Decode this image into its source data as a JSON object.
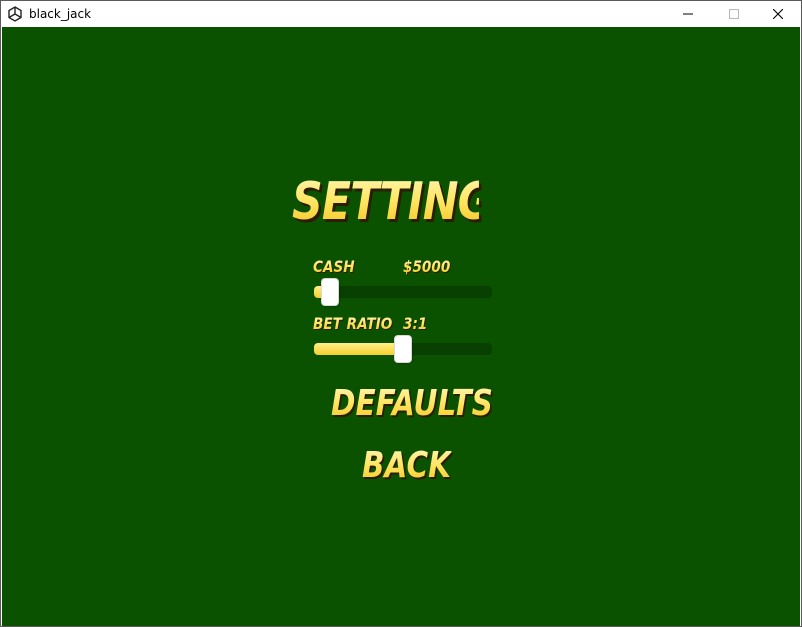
{
  "window": {
    "title": "black_jack",
    "app_icon": "unity-icon",
    "controls": {
      "minimize_icon": "minimize-icon",
      "maximize_icon": "maximize-icon",
      "close_icon": "close-icon"
    }
  },
  "colors": {
    "felt": "#0b5200",
    "text_gold": "#ffe766",
    "slider_track": "#074000",
    "slider_fill": "#f5cf2c"
  },
  "settings": {
    "title": "SETTINGS",
    "cash": {
      "label": "CASH",
      "value": "$5000",
      "level": 0.09
    },
    "bet_ratio": {
      "label": "BET RATIO",
      "value": "3:1",
      "level": 0.5
    },
    "defaults_label": "DEFAULTS",
    "back_label": "BACK"
  }
}
